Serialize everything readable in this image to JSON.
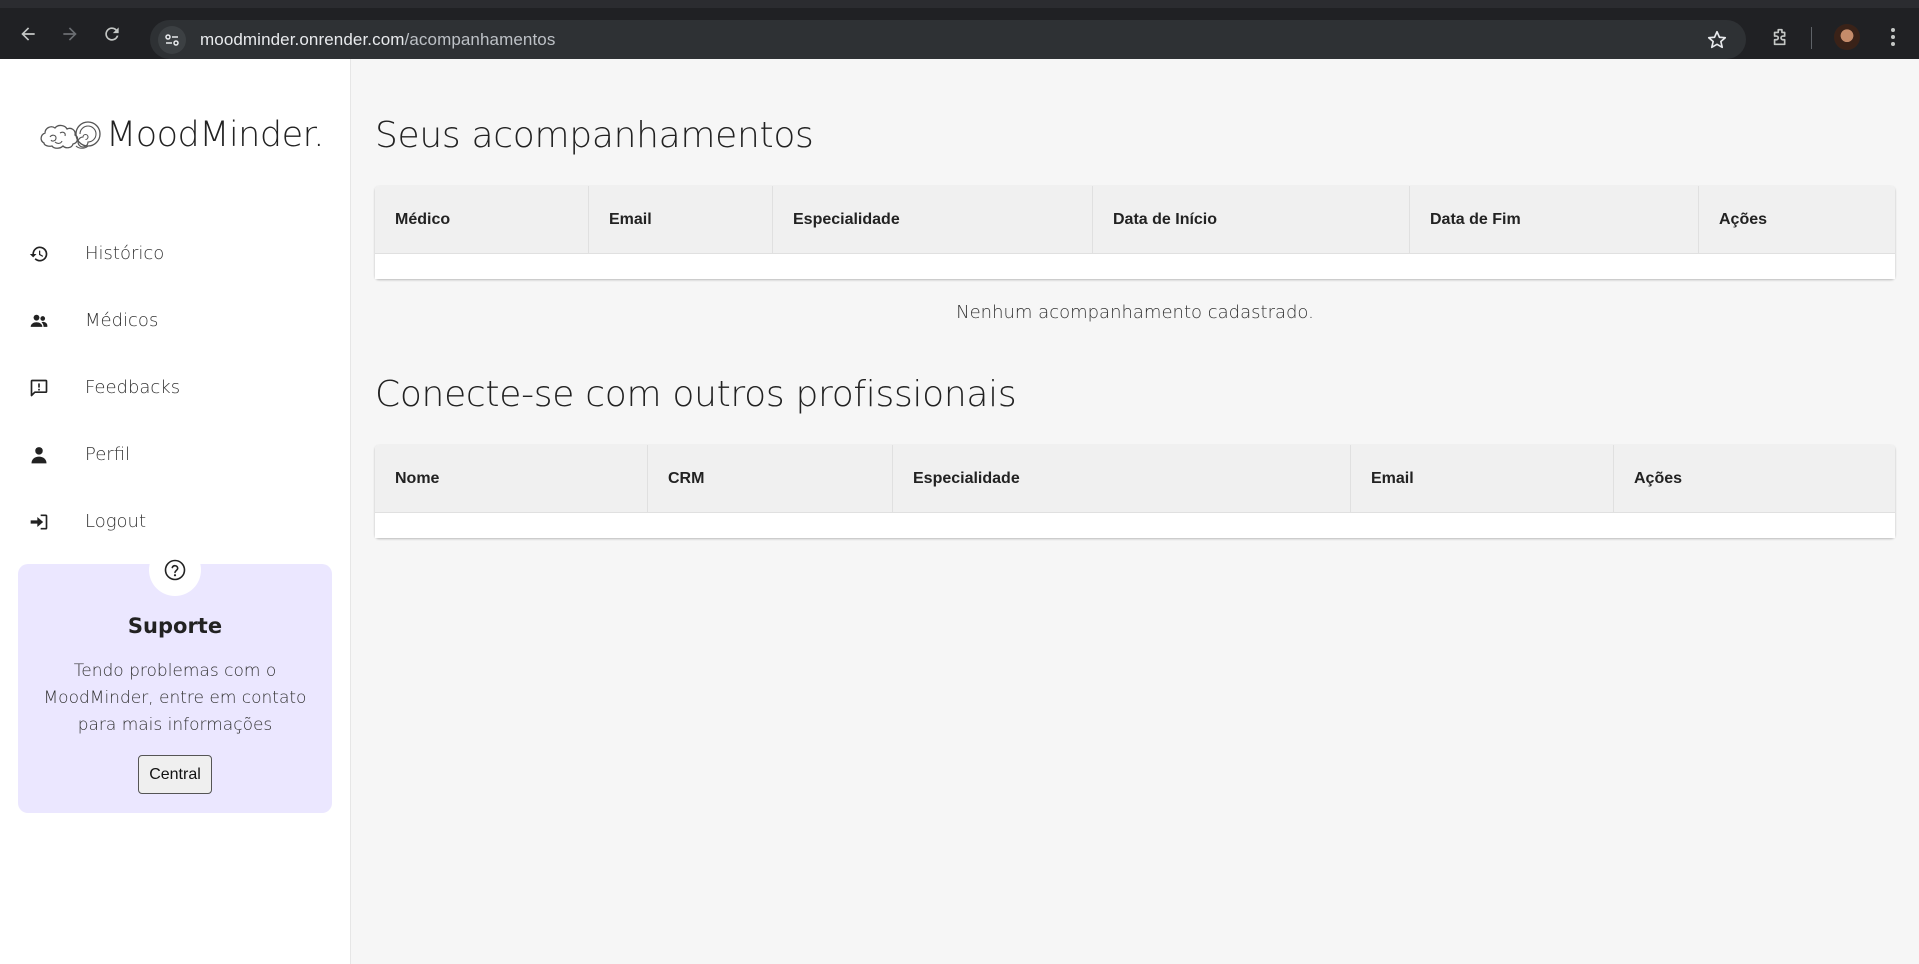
{
  "browser": {
    "url_host": "moodminder.onrender.com",
    "url_path": "/acompanhamentos"
  },
  "sidebar": {
    "logo_text": "MoodMinder.",
    "items": [
      {
        "label": "Histórico",
        "icon": "history-icon"
      },
      {
        "label": "Médicos",
        "icon": "users-icon"
      },
      {
        "label": "Feedbacks",
        "icon": "feedback-icon"
      },
      {
        "label": "Perfil",
        "icon": "user-icon"
      },
      {
        "label": "Logout",
        "icon": "logout-icon"
      }
    ],
    "support": {
      "title": "Suporte",
      "text": "Tendo problemas com o MoodMinder, entre em contato para mais informações",
      "button": "Central"
    }
  },
  "main": {
    "section1": {
      "title": "Seus acompanhamentos",
      "columns": [
        "Médico",
        "Email",
        "Especialidade",
        "Data de Início",
        "Data de Fim",
        "Ações"
      ],
      "rows": [],
      "empty_message": "Nenhum acompanhamento cadastrado."
    },
    "section2": {
      "title": "Conecte-se com outros profissionais",
      "columns": [
        "Nome",
        "CRM",
        "Especialidade",
        "Email",
        "Ações"
      ],
      "rows": []
    }
  },
  "colors": {
    "support_bg": "#ebe7ff",
    "page_bg": "#f6f6f6",
    "chrome_bg": "#202124"
  }
}
